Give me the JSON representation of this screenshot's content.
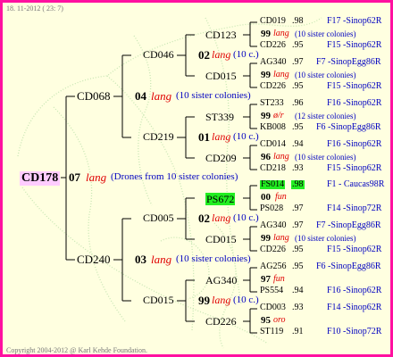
{
  "header": {
    "date": "18. 11-2012 ( 23: 7)"
  },
  "footer": {
    "copyright": "Copyright 2004-2012 @ Karl Kehde Foundation."
  },
  "colors": {
    "frame": "#ff10a0",
    "background": "#ffffe0",
    "highlight": "#22ee22",
    "root_bg": "#ffccff",
    "lines": "#000000",
    "red_text": "#e00000",
    "blue_text": "#0000c0"
  },
  "root": {
    "id": "CD178",
    "gen": "07",
    "lang": "lang",
    "desc": "(Drones from 10 sister colonies)"
  },
  "g1": [
    {
      "id": "CD068",
      "gen": "04",
      "lang": "lang",
      "desc": "(10 sister colonies)"
    },
    {
      "id": "CD240",
      "gen": "03",
      "lang": "lang",
      "desc": "(10 sister colonies)"
    }
  ],
  "g2": [
    {
      "id": "CD046",
      "gen": "02",
      "lang": "lang",
      "desc": "(10 c.)"
    },
    {
      "id": "CD219",
      "gen": "01",
      "lang": "lang",
      "desc": "(10 c.)"
    },
    {
      "id": "CD005",
      "gen": "02",
      "lang": "lang",
      "desc": "(10 c.)"
    },
    {
      "id": "CD015",
      "gen": "99",
      "lang": "lang",
      "desc": "(10 c.)"
    }
  ],
  "g3": [
    {
      "id": "CD123",
      "gen": "99",
      "lang": "lang",
      "desc": "(10 sister colonies)"
    },
    {
      "id": "CD015",
      "gen": "99",
      "lang": "lang",
      "desc": "(10 sister colonies)"
    },
    {
      "id": "ST339",
      "gen": "99",
      "lang": "ø/r",
      "desc": "(12 sister colonies)"
    },
    {
      "id": "CD209",
      "gen": "96",
      "lang": "lang",
      "desc": "(10 sister colonies)"
    },
    {
      "id": "PS672",
      "gen": "00",
      "lang": "fun",
      "desc": ""
    },
    {
      "id": "CD015",
      "gen": "99",
      "lang": "lang",
      "desc": "(10 sister colonies)"
    },
    {
      "id": "AG340",
      "gen": "97",
      "lang": "fun",
      "desc": ""
    },
    {
      "id": "CD226",
      "gen": "95",
      "lang": "oro",
      "desc": ""
    }
  ],
  "g4": [
    {
      "id": "CD019",
      "val": ".98",
      "src": "F17 -Sinop62R"
    },
    {
      "id": "CD226",
      "val": ".95",
      "src": "F15 -Sinop62R"
    },
    {
      "id": "AG340",
      "val": ".97",
      "src": "F7 -SinopEgg86R"
    },
    {
      "id": "CD226",
      "val": ".95",
      "src": "F15 -Sinop62R"
    },
    {
      "id": "ST233",
      "val": ".96",
      "src": "F16 -Sinop62R"
    },
    {
      "id": "KB008",
      "val": ".95",
      "src": "F6 -SinopEgg86R"
    },
    {
      "id": "CD014",
      "val": ".94",
      "src": "F16 -Sinop62R"
    },
    {
      "id": "CD218",
      "val": ".93",
      "src": "F15 -Sinop62R"
    },
    {
      "id": "FS014",
      "val": ".98",
      "src": "F1 - Caucas98R"
    },
    {
      "id": "PS028",
      "val": ".97",
      "src": "F14 -Sinop72R"
    },
    {
      "id": "AG340",
      "val": ".97",
      "src": "F7 -SinopEgg86R"
    },
    {
      "id": "CD226",
      "val": ".95",
      "src": "F15 -Sinop62R"
    },
    {
      "id": "AG256",
      "val": ".95",
      "src": "F6 -SinopEgg86R"
    },
    {
      "id": "PS554",
      "val": ".94",
      "src": "F16 -Sinop62R"
    },
    {
      "id": "CD003",
      "val": ".93",
      "src": "F14 -Sinop62R"
    },
    {
      "id": "ST119",
      "val": ".91",
      "src": "F10 -Sinop72R"
    }
  ]
}
